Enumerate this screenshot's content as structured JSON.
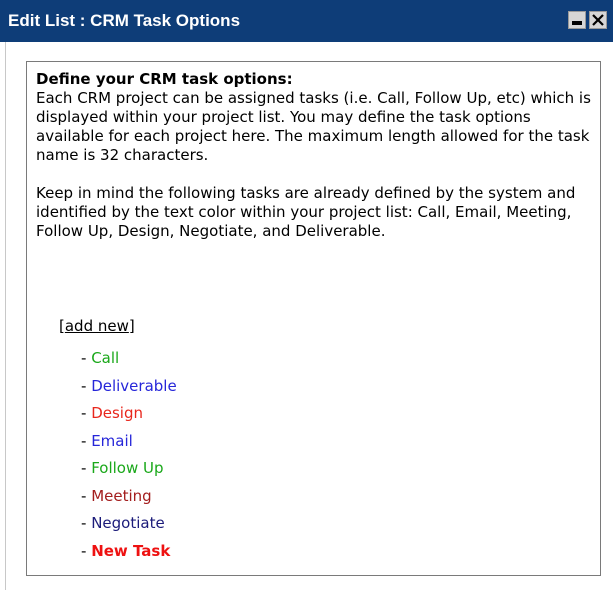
{
  "window": {
    "title": "Edit List : CRM Task Options"
  },
  "intro": {
    "heading": "Define your CRM task options:",
    "paragraph1": "Each CRM project can be assigned tasks (i.e. Call, Follow Up, etc) which is displayed within your project list. You may define the task options available for each project here. The maximum length allowed for the task name is 32 characters.",
    "paragraph2": "Keep in mind the following tasks are already defined by the system and identified by the text color within your project list: Call, Email, Meeting, Follow Up, Design, Negotiate, and Deliverable."
  },
  "add_new": {
    "open_bracket": "[",
    "label": "add new",
    "close_bracket": "]"
  },
  "tasks": [
    {
      "label": "Call",
      "color": "#1aa81a",
      "bold": false
    },
    {
      "label": "Deliverable",
      "color": "#2626d9",
      "bold": false
    },
    {
      "label": "Design",
      "color": "#e8261c",
      "bold": false
    },
    {
      "label": "Email",
      "color": "#2626d9",
      "bold": false
    },
    {
      "label": "Follow Up",
      "color": "#1aa81a",
      "bold": false
    },
    {
      "label": "Meeting",
      "color": "#a31d1d",
      "bold": false
    },
    {
      "label": "Negotiate",
      "color": "#1c1c7a",
      "bold": false
    },
    {
      "label": "New Task",
      "color": "#ee1111",
      "bold": true
    }
  ],
  "colors": {
    "titlebar": "#0e3d78",
    "title_text": "#ffffff"
  }
}
